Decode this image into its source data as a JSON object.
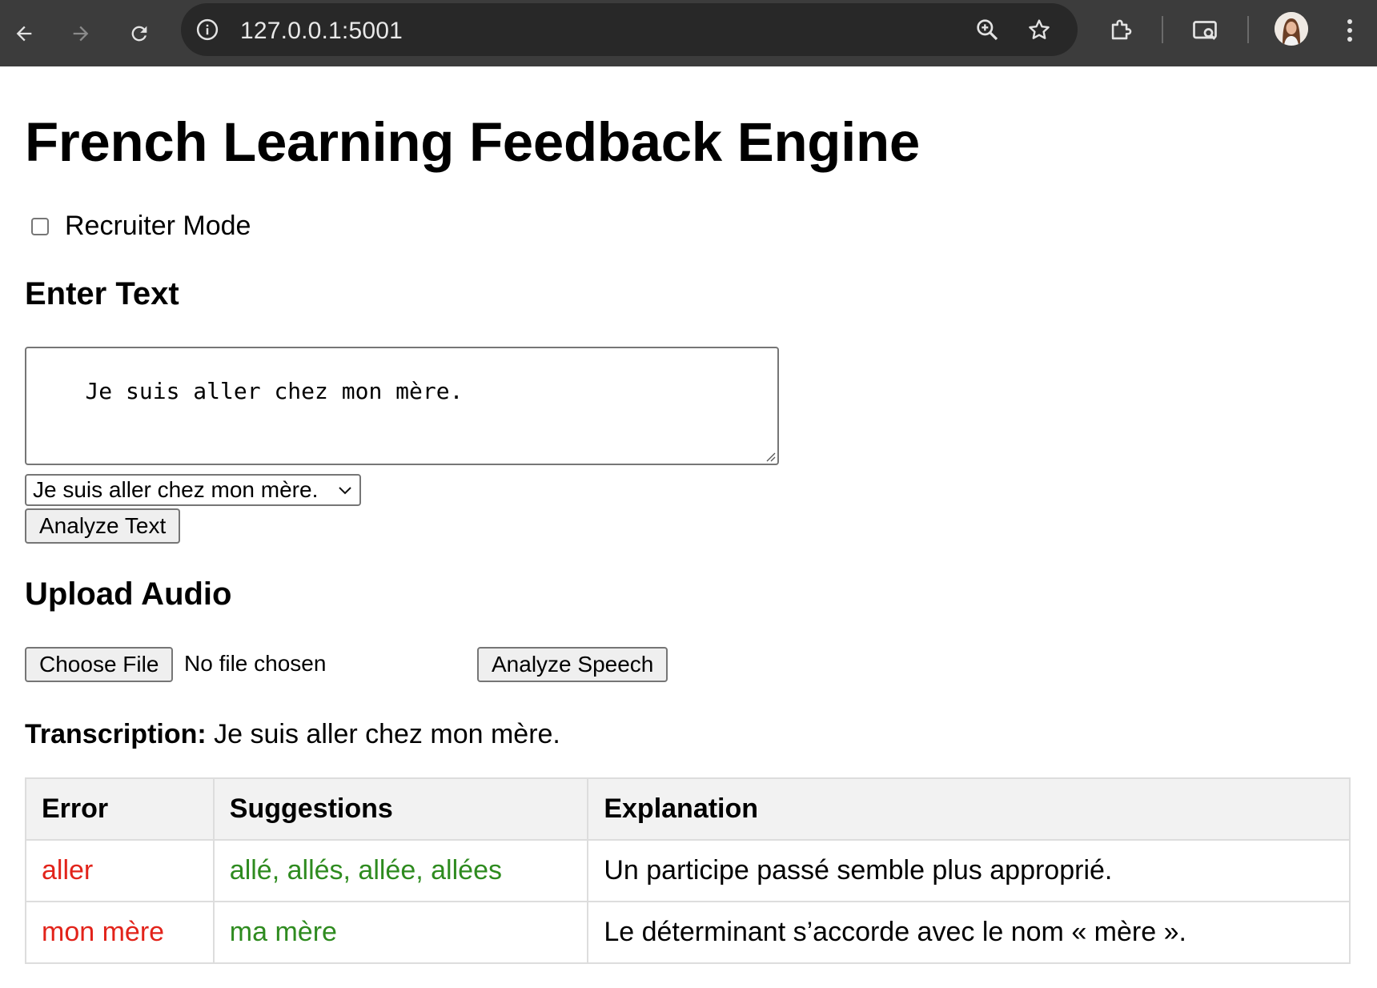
{
  "browser": {
    "url": "127.0.0.1:5001",
    "icons": [
      "back-icon",
      "forward-icon",
      "reload-icon",
      "site-info-icon",
      "zoom-icon",
      "bookmark-star-icon",
      "extensions-icon",
      "cast-icon",
      "profile-avatar",
      "menu-icon"
    ]
  },
  "page": {
    "title": "French Learning Feedback Engine",
    "recruiter_mode_label": "Recruiter Mode",
    "recruiter_mode_checked": false,
    "enter_text_heading": "Enter Text",
    "textarea_value": "Je suis aller chez mon mère.",
    "select_value": "Je suis aller chez mon mère.",
    "analyze_text_button": "Analyze Text",
    "upload_audio_heading": "Upload Audio",
    "choose_file_button": "Choose File",
    "file_status": "No file chosen",
    "analyze_speech_button": "Analyze Speech",
    "transcription_label": "Transcription:",
    "transcription_value": "Je suis aller chez mon mère."
  },
  "results": {
    "headers": [
      "Error",
      "Suggestions",
      "Explanation"
    ],
    "rows": [
      {
        "error": "aller",
        "suggestions": "allé, allés, allée, allées",
        "explanation": "Un participe passé semble plus approprié."
      },
      {
        "error": "mon mère",
        "suggestions": "ma mère",
        "explanation": "Le déterminant s’accorde avec le nom « mère »."
      }
    ]
  },
  "colors": {
    "chrome_bg": "#3c3c3c",
    "omnibox_bg": "#282828",
    "error_text": "#e2231a",
    "suggestion_text": "#2e8b1f",
    "table_header_bg": "#f2f2f2"
  }
}
